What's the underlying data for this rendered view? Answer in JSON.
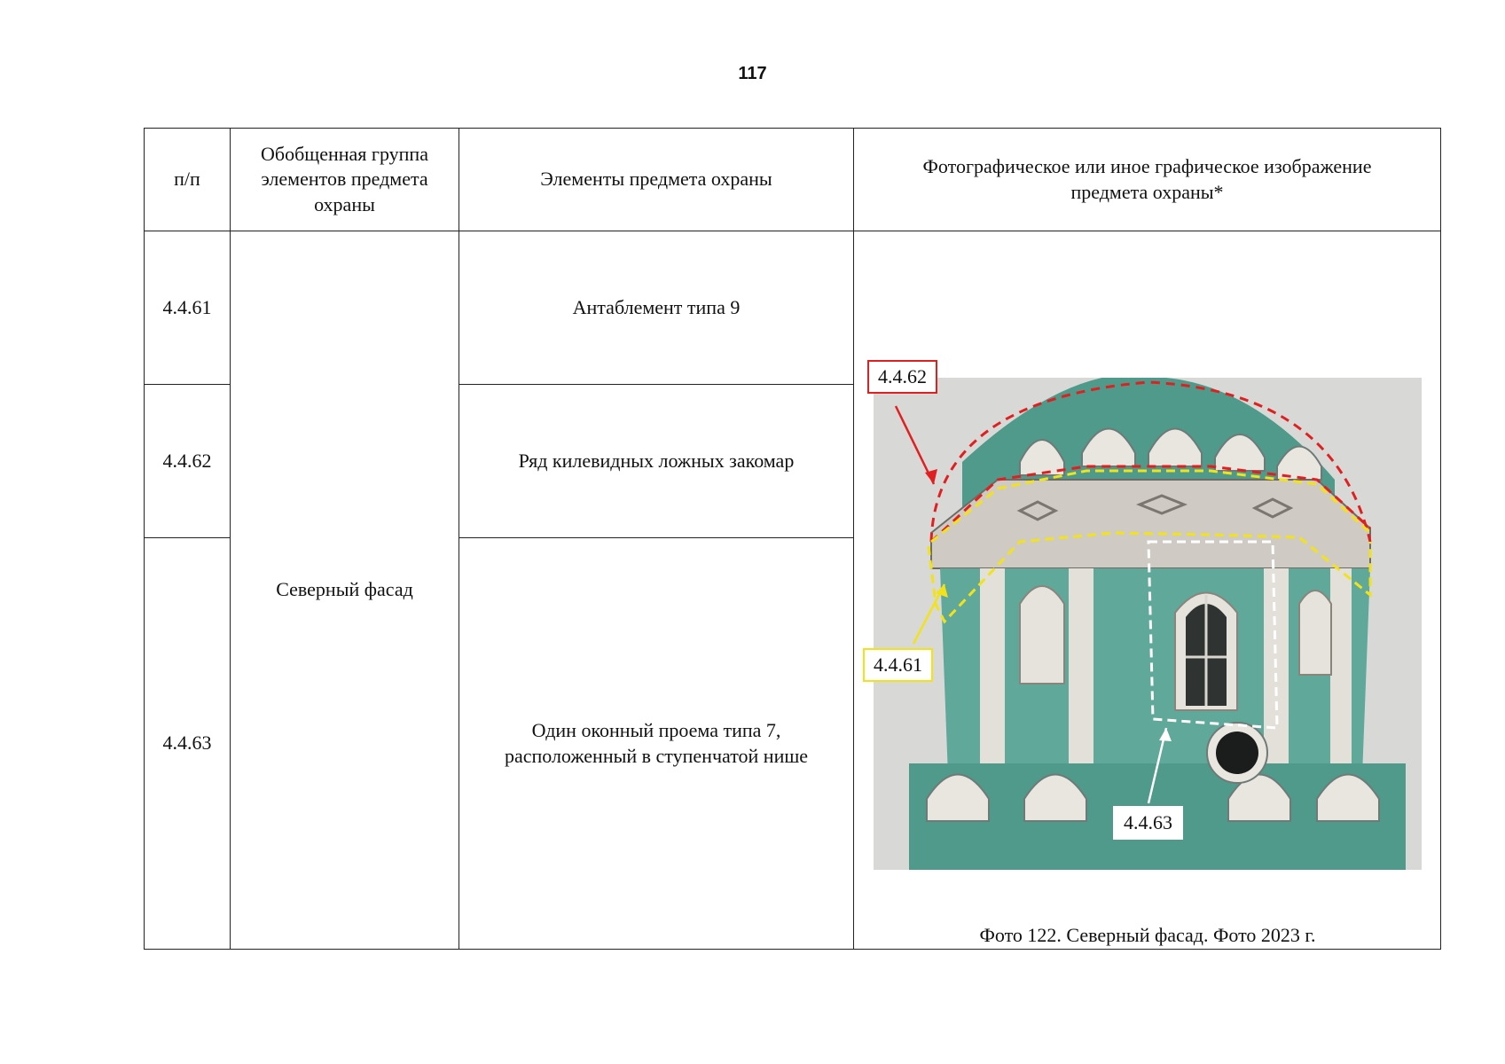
{
  "page_number": "117",
  "table": {
    "headers": {
      "num": "п/п",
      "group": "Обобщенная группа элементов предмета охраны",
      "elements": "Элементы предмета охраны",
      "image": "Фотографическое или иное графическое изображение предмета охраны*"
    },
    "group_value": "Северный фасад",
    "rows": [
      {
        "num": "4.4.61",
        "element": "Антаблемент типа 9"
      },
      {
        "num": "4.4.62",
        "element": "Ряд килевидных ложных закомар"
      },
      {
        "num": "4.4.63",
        "element": "Один оконный проема типа 7, расположенный в ступенчатой нише"
      }
    ]
  },
  "photo": {
    "callouts": {
      "c62": "4.4.62",
      "c61": "4.4.61",
      "c63": "4.4.63"
    },
    "caption": "Фото 122. Северный фасад. Фото 2023 г."
  },
  "colors": {
    "annotation_red": "#e02020",
    "annotation_yellow": "#f2e21a",
    "annotation_white": "#ffffff",
    "facade_teal": "#5fa89a",
    "sky": "#d7d8d6"
  }
}
